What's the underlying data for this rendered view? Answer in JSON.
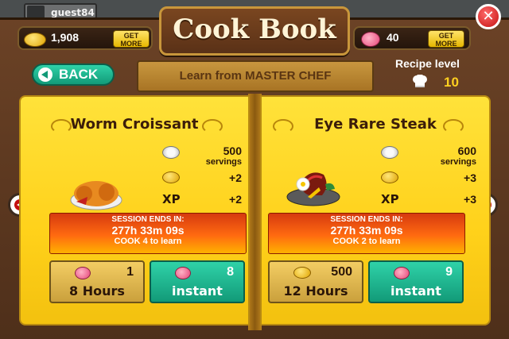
{
  "header": {
    "guest_name": "guest84",
    "title": "Cook Book",
    "coins": "1,908",
    "coins_get_more": "GET MORE",
    "brains": "40",
    "brains_get_more": "GET MORE"
  },
  "nav": {
    "back_label": "BACK",
    "banner": "Learn from MASTER CHEF",
    "recipe_level_label": "Recipe level",
    "recipe_level": "10"
  },
  "recipes": [
    {
      "name": "Worm Croissant",
      "servings": "500",
      "servings_label": "servings",
      "coins_reward": "+2",
      "xp_label": "XP",
      "xp_reward": "+2",
      "session_header": "SESSION ENDS IN:",
      "session_time": "277h 33m 09s",
      "cook_note": "COOK 4 to learn",
      "option_a": {
        "value": "1",
        "label": "8 Hours"
      },
      "option_b": {
        "value": "8",
        "label": "instant"
      }
    },
    {
      "name": "Eye Rare Steak",
      "servings": "600",
      "servings_label": "servings",
      "coins_reward": "+3",
      "xp_label": "XP",
      "xp_reward": "+3",
      "session_header": "SESSION ENDS IN:",
      "session_time": "277h 33m 09s",
      "cook_note": "COOK 2 to learn",
      "option_a": {
        "value": "500",
        "label": "12 Hours"
      },
      "option_b": {
        "value": "9",
        "label": "instant"
      }
    }
  ]
}
